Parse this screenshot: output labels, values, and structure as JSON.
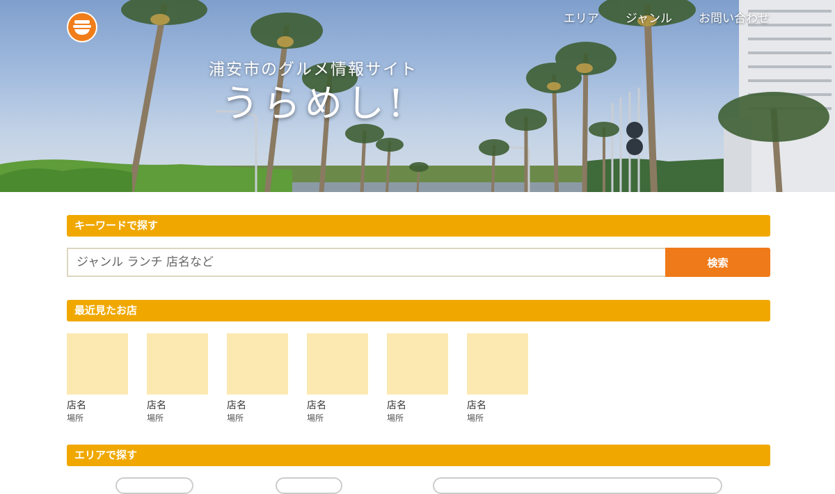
{
  "header": {
    "nav": [
      "エリア",
      "ジャンル",
      "お問い合わせ"
    ],
    "subtitle": "浦安市のグルメ情報サイト",
    "title": "うらめし!"
  },
  "keyword_section": {
    "title": "キーワードで探す",
    "placeholder": "ジャンル ランチ 店名など",
    "button": "検索"
  },
  "recent_section": {
    "title": "最近見たお店",
    "shops": [
      {
        "name": "店名",
        "place": "場所"
      },
      {
        "name": "店名",
        "place": "場所"
      },
      {
        "name": "店名",
        "place": "場所"
      },
      {
        "name": "店名",
        "place": "場所"
      },
      {
        "name": "店名",
        "place": "場所"
      },
      {
        "name": "店名",
        "place": "場所"
      }
    ]
  },
  "area_section": {
    "title": "エリアで探す"
  },
  "colors": {
    "accent": "#f0a800",
    "button": "#ef7a1a",
    "thumbnail": "#fce9b2",
    "logo": "#f07d1a"
  },
  "icons": [
    "logo-icon",
    "palm-tree-image"
  ]
}
